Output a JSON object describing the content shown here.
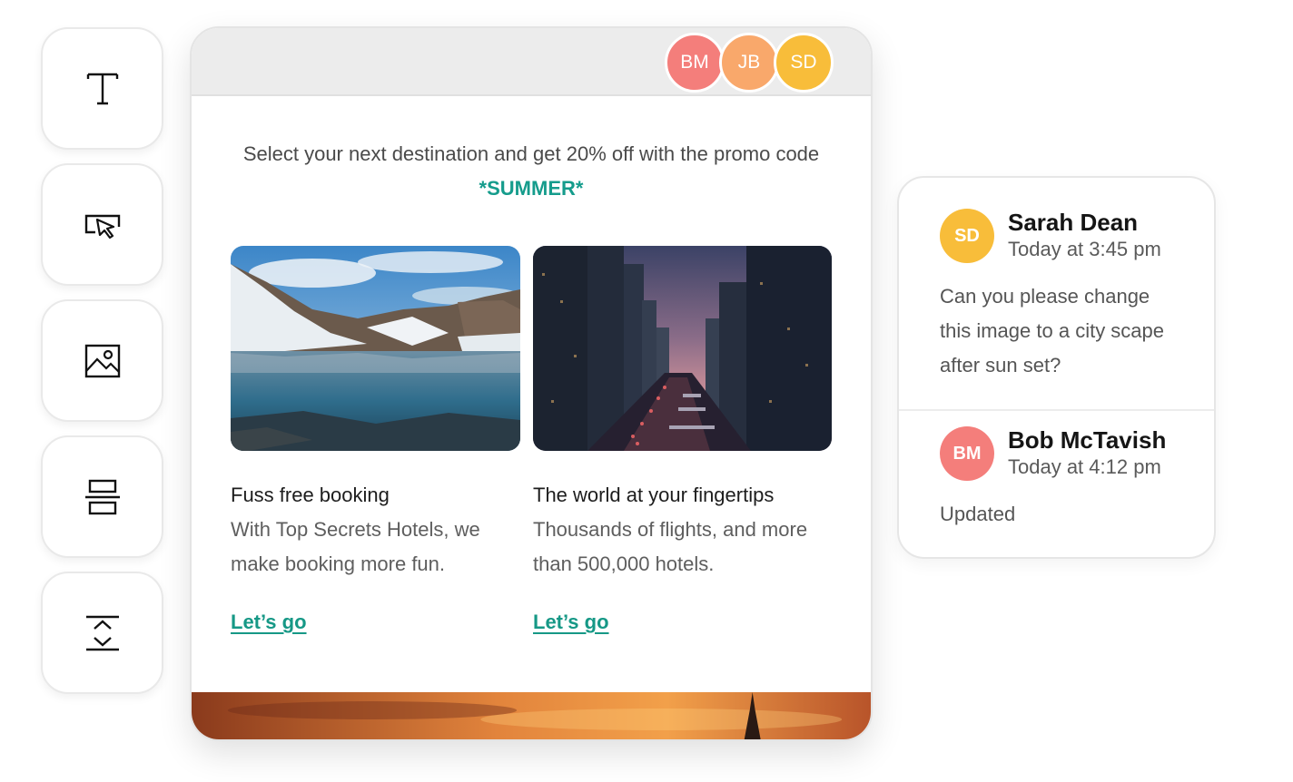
{
  "toolbar": {
    "tools": [
      {
        "name": "text-tool",
        "icon": "text-icon"
      },
      {
        "name": "button-tool",
        "icon": "cursor-button-icon"
      },
      {
        "name": "image-tool",
        "icon": "image-icon"
      },
      {
        "name": "layout-tool",
        "icon": "layout-stack-icon"
      },
      {
        "name": "spacer-tool",
        "icon": "expand-collapse-icon"
      }
    ]
  },
  "canvas": {
    "collaborators": [
      {
        "initials": "BM",
        "color": "#f47e7b"
      },
      {
        "initials": "JB",
        "color": "#f9a86b"
      },
      {
        "initials": "SD",
        "color": "#f8bd3a"
      }
    ],
    "promo": {
      "text": "Select your next destination and get 20% off with the promo code",
      "code": "*SUMMER*"
    },
    "cards": [
      {
        "image": "glacier-lake-photo",
        "title": "Fuss free booking",
        "description": "With Top Secrets Hotels, we make booking more fun.",
        "link": "Let’s go"
      },
      {
        "image": "city-sunset-photo",
        "title": "The world at your fingertips",
        "description": "Thousands of flights, and more than 500,000 hotels.",
        "link": "Let’s go"
      }
    ],
    "footer_image": "sunset-skyline-photo"
  },
  "comments": [
    {
      "initials": "SD",
      "color": "#f8bd3a",
      "name": "Sarah Dean",
      "time": "Today at 3:45 pm",
      "text": "Can you please change this image to a city scape after sun set?"
    },
    {
      "initials": "BM",
      "color": "#f47e7b",
      "name": "Bob McTavish",
      "time": "Today at 4:12 pm",
      "text": "Updated"
    }
  ],
  "colors": {
    "accent": "#159c8c",
    "link": "#169886"
  }
}
